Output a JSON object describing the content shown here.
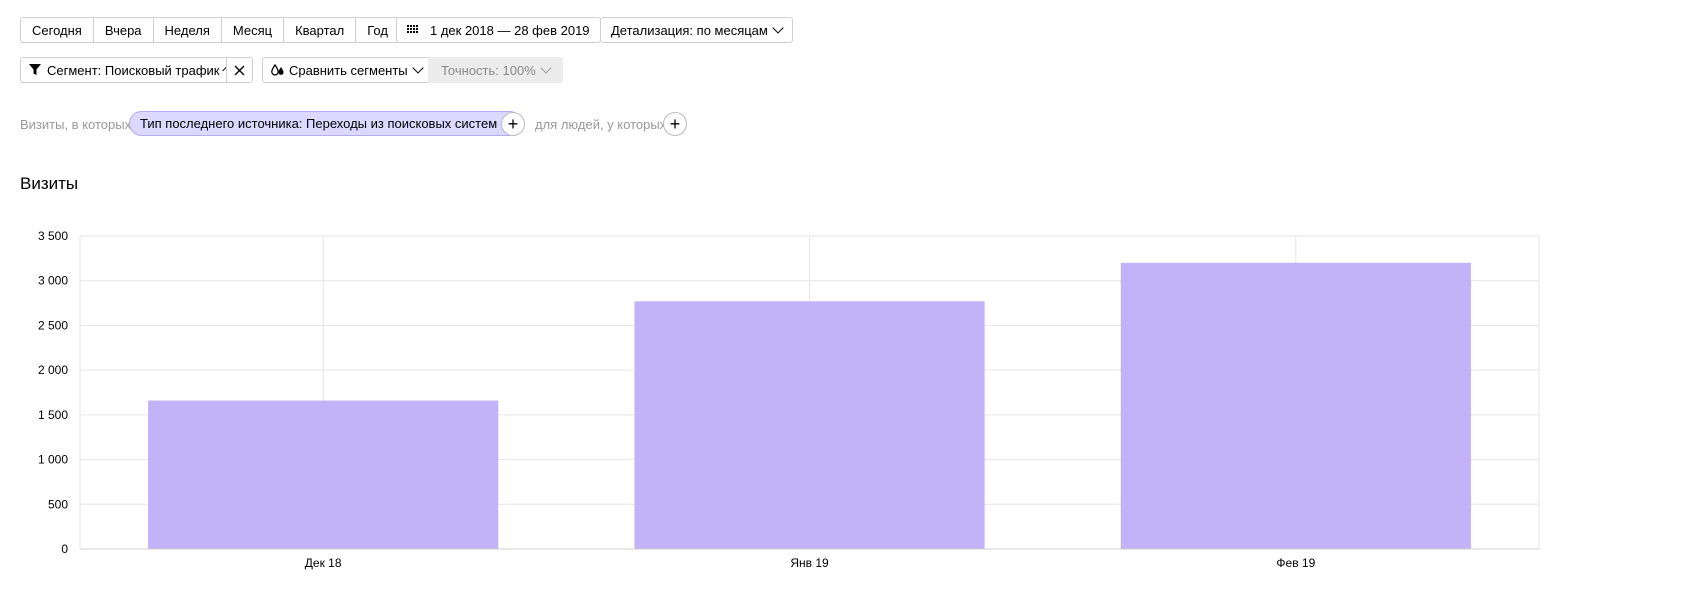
{
  "periods": [
    "Сегодня",
    "Вчера",
    "Неделя",
    "Месяц",
    "Квартал",
    "Год"
  ],
  "date_range": "1 дек 2018 — 28 фев 2019",
  "detail": "Детализация: по месяцам",
  "segment": "Сегмент: Поисковый трафик",
  "compare": "Сравнить сегменты",
  "accuracy": "Точность: 100%",
  "filter": {
    "visits_label": "Визиты, в которых",
    "chip": "Тип последнего источника: Переходы из поисковых систем",
    "people_label": "для людей, у которых"
  },
  "icons": {
    "calendar": "calendar-icon",
    "funnel": "funnel-icon",
    "compare": "drops-icon",
    "close": "close-icon",
    "plus": "plus-icon",
    "chevron": "chevron-down-icon"
  },
  "colors": {
    "bar": "#c2b2f8",
    "chip_bg": "#dcd8ff",
    "chip_border": "#b3acf2",
    "grid": "#e6e6e6"
  },
  "chart_data": {
    "type": "bar",
    "title": "Визиты",
    "categories": [
      "Дек 18",
      "Янв 19",
      "Фев 19"
    ],
    "values": [
      1660,
      2770,
      3200
    ],
    "ylim": [
      0,
      3500
    ],
    "yticks": [
      0,
      500,
      1000,
      1500,
      2000,
      2500,
      3000,
      3500
    ],
    "ytick_labels": [
      "0",
      "500",
      "1 000",
      "1 500",
      "2 000",
      "2 500",
      "3 000",
      "3 500"
    ],
    "grid": true
  }
}
